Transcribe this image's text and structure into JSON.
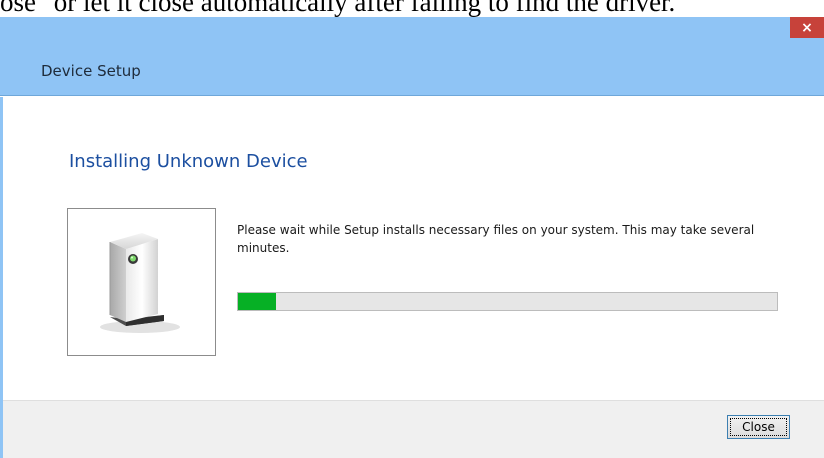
{
  "background_text": "ose\" or let it close automatically after failing to find the driver.",
  "window": {
    "title": "Device Setup",
    "close_glyph": "×",
    "heading": "Installing Unknown Device",
    "message": "Please wait while Setup installs necessary files on your system. This may take several minutes.",
    "progress_fraction": 0.07,
    "progress_color": "#06b025",
    "device_icon": "device-tower-icon",
    "close_button_label": "Close"
  },
  "colors": {
    "titlebar": "#8fc4f5",
    "close_x": "#c7423a",
    "heading": "#1c4fa0"
  }
}
